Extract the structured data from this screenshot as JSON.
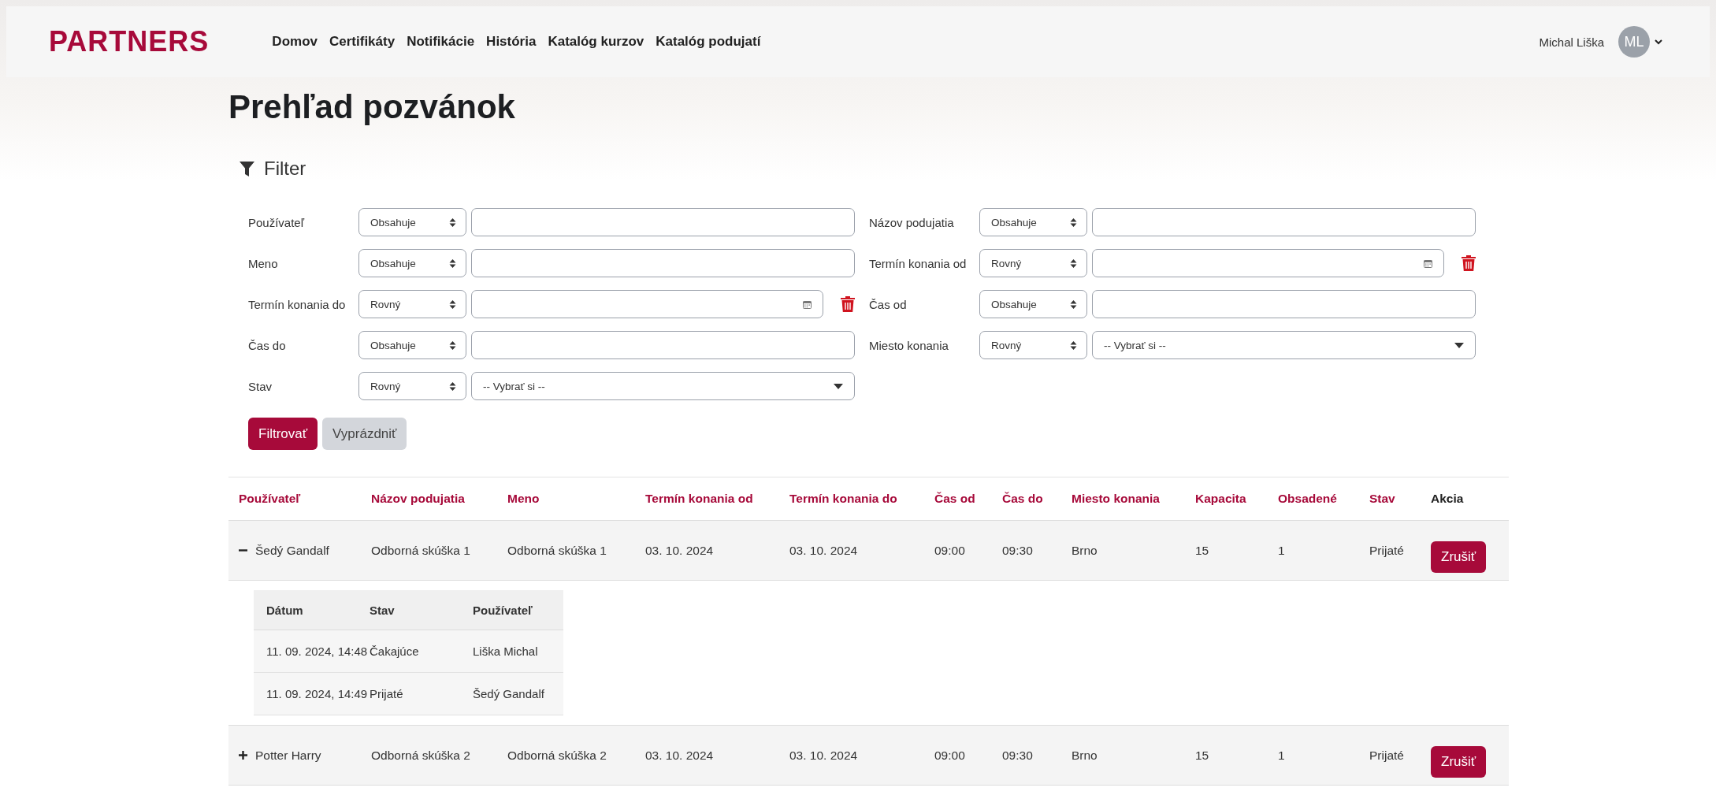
{
  "header": {
    "logo": "PARTNERS",
    "nav": [
      "Domov",
      "Certifikáty",
      "Notifikácie",
      "História",
      "Katalóg kurzov",
      "Katalóg podujatí"
    ],
    "user": {
      "name": "Michal Liška",
      "initials": "ML"
    }
  },
  "page": {
    "title": "Prehľad pozvánok"
  },
  "filter": {
    "title": "Filter",
    "columns": [
      [
        {
          "label": "Používateľ",
          "operator": "Obsahuje",
          "kind": "text"
        },
        {
          "label": "Meno",
          "operator": "Obsahuje",
          "kind": "text"
        },
        {
          "label": "Termín konania do",
          "operator": "Rovný",
          "kind": "date"
        },
        {
          "label": "Čas do",
          "operator": "Obsahuje",
          "kind": "text"
        },
        {
          "label": "Stav",
          "operator": "Rovný",
          "kind": "select",
          "value": "-- Vybrať si --"
        }
      ],
      [
        {
          "label": "Názov podujatia",
          "operator": "Obsahuje",
          "kind": "text"
        },
        {
          "label": "Termín konania od",
          "operator": "Rovný",
          "kind": "date"
        },
        {
          "label": "Čas od",
          "operator": "Obsahuje",
          "kind": "text"
        },
        {
          "label": "Miesto konania",
          "operator": "Rovný",
          "kind": "select",
          "value": "-- Vybrať si --"
        }
      ]
    ],
    "buttons": [
      {
        "label": "Filtrovať",
        "kind": "primary"
      },
      {
        "label": "Vyprázdniť",
        "kind": "secondary"
      }
    ]
  },
  "table": {
    "columns": [
      {
        "label": "Používateľ",
        "sortable": true
      },
      {
        "label": "Názov podujatia",
        "sortable": true
      },
      {
        "label": "Meno",
        "sortable": true
      },
      {
        "label": "Termín konania od",
        "sortable": true
      },
      {
        "label": "Termín konania do",
        "sortable": true
      },
      {
        "label": "Čas od",
        "sortable": true
      },
      {
        "label": "Čas do",
        "sortable": true
      },
      {
        "label": "Miesto konania",
        "sortable": true
      },
      {
        "label": "Kapacita",
        "sortable": true
      },
      {
        "label": "Obsadené",
        "sortable": true
      },
      {
        "label": "Stav",
        "sortable": true
      },
      {
        "label": "Akcia",
        "sortable": false
      }
    ],
    "rows": [
      {
        "expanded": true,
        "cells": [
          "Šedý Gandalf",
          "Odborná skúška 1",
          "Odborná skúška 1",
          "03. 10. 2024",
          "03. 10. 2024",
          "09:00",
          "09:30",
          "Brno",
          "15",
          "1",
          "Prijaté"
        ],
        "action": "Zrušiť",
        "history": {
          "columns": [
            "Dátum",
            "Stav",
            "Používateľ"
          ],
          "rows": [
            [
              "11. 09. 2024, 14:48",
              "Čakajúce",
              "Liška Michal"
            ],
            [
              "11. 09. 2024, 14:49",
              "Prijaté",
              "Šedý Gandalf"
            ]
          ]
        }
      },
      {
        "expanded": false,
        "cells": [
          "Potter Harry",
          "Odborná skúška 2",
          "Odborná skúška 2",
          "03. 10. 2024",
          "03. 10. 2024",
          "09:00",
          "09:30",
          "Brno",
          "15",
          "1",
          "Prijaté"
        ],
        "action": "Zrušiť"
      }
    ]
  }
}
